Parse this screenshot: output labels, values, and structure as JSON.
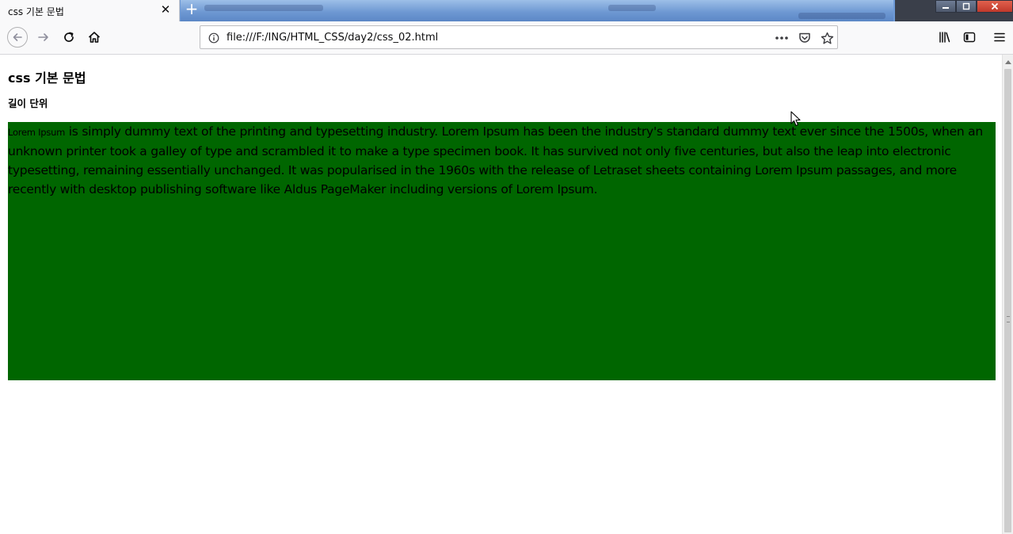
{
  "tab": {
    "title": "css 기본 문법"
  },
  "navbar": {
    "url": "file:///F:/ING/HTML_CSS/day2/css_02.html"
  },
  "page": {
    "heading": "css 기본 문법",
    "subheading": "길이 단위",
    "paragraph_small": "Lorem Ipsum",
    "paragraph_text": " is simply dummy text of the printing and typesetting industry. Lorem Ipsum has been the industry's standard dummy text ever since the 1500s, when an unknown printer took a galley of type and scrambled it to make a type specimen book. It has survived not only five centuries, but also the leap into electronic typesetting, remaining essentially unchanged. It was popularised in the 1960s with the release of Letraset sheets containing Lorem Ipsum passages, and more recently with desktop publishing software like Aldus PageMaker including versions of Lorem Ipsum.",
    "box_color": "#006600"
  },
  "icons": {
    "back": "back-arrow-icon",
    "forward": "forward-arrow-icon",
    "reload": "reload-icon",
    "home": "home-icon",
    "info": "info-icon",
    "page_actions": "more-icon",
    "pocket": "pocket-icon",
    "bookmark": "star-icon",
    "library": "library-icon",
    "sidebar": "sidebar-icon",
    "menu": "hamburger-menu-icon"
  }
}
